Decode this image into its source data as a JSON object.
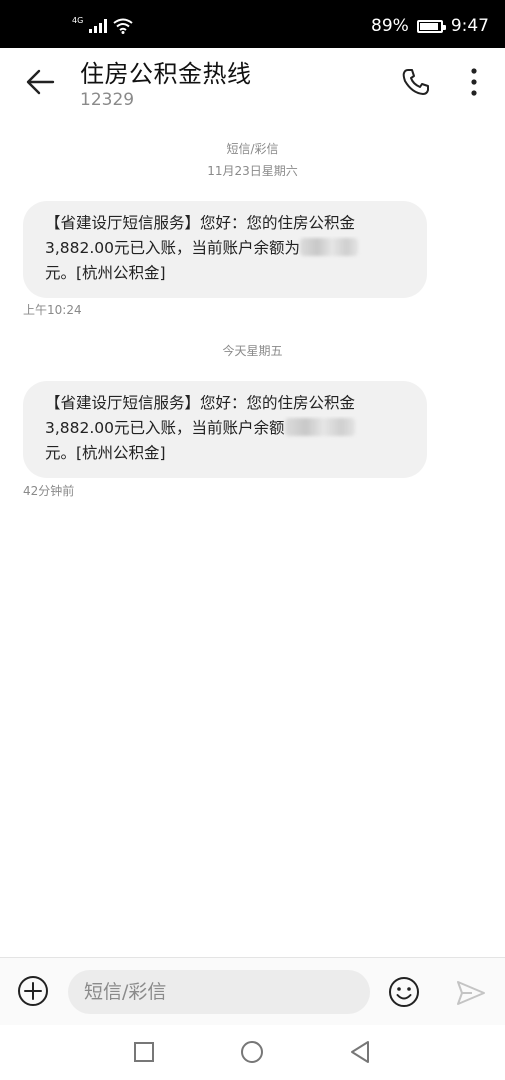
{
  "status_bar": {
    "network": "4G",
    "battery_percent": "89%",
    "battery_level": 0.89,
    "time": "9:47"
  },
  "header": {
    "title": "住房公积金热线",
    "number": "12329"
  },
  "thread": {
    "type_label": "短信/彩信",
    "groups": [
      {
        "date_label": "11月23日星期六",
        "message": {
          "line1": "【省建设厅短信服务】您好：您的住房公积金",
          "line2_prefix": "3,882.00元已入账，当前账户余额为",
          "line3": "元。[杭州公积金]",
          "time": "上午10:24"
        }
      },
      {
        "date_label": "今天星期五",
        "message": {
          "line1": "【省建设厅短信服务】您好：您的住房公积金",
          "line2_prefix": "3,882.00元已入账，当前账户余额",
          "line3": "元。[杭州公积金]",
          "time": "42分钟前"
        }
      }
    ]
  },
  "composer": {
    "placeholder": "短信/彩信"
  },
  "icons": {
    "back": "arrow-left-icon",
    "call": "phone-icon",
    "more": "more-vertical-icon",
    "add": "plus-circle-icon",
    "emoji": "smiley-icon",
    "send": "send-icon",
    "nav_recent": "square-icon",
    "nav_home": "circle-icon",
    "nav_back": "triangle-back-icon"
  },
  "colors": {
    "bubble_bg": "#f1f1f1",
    "secondary_text": "#8a8a8a",
    "status_bar_bg": "#000000"
  }
}
